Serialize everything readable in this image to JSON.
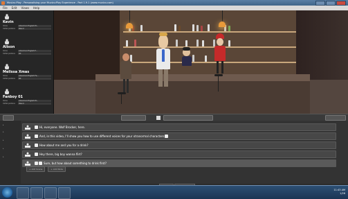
{
  "window": {
    "title": "Muvizu:Play - Personalising your Muvizu:Play Experience - Part 1.9.1 (www.muvizu.com)",
    "menu": [
      "File",
      "Edit",
      "Views",
      "Help"
    ]
  },
  "sidebar": {
    "characters": [
      {
        "name": "Kevin",
        "voice_label": "Voice",
        "voice": "American English M...",
        "pose_label": "Initial posture",
        "pose": "Stand"
      },
      {
        "name": "Alison",
        "voice_label": "Voice",
        "voice": "American English F...",
        "pose_label": "Initial posture",
        "pose": "Sit"
      },
      {
        "name": "Melissa Xmas",
        "voice_label": "Voice",
        "voice": "American English Fe...",
        "pose_label": "Initial posture",
        "pose": "Sit"
      },
      {
        "name": "Fanboy 01",
        "voice_label": "Voice",
        "voice": "American English M...",
        "pose_label": "Initial posture",
        "pose": "Stand"
      }
    ]
  },
  "script": {
    "lines": [
      {
        "text": "Hi, everyone.  Wolf Brocker, here."
      },
      {
        "text": "And, in this video, I'll show you how to use different voices for your xtranormal characters"
      },
      {
        "text": "How about  me and you for a drink?"
      },
      {
        "text": "Hey there, big boy  wanna flirt?"
      },
      {
        "text": "Sure, but how about  something to drink first?"
      }
    ],
    "add_buttons": [
      "+ Add Scene",
      "+ Add Slide"
    ]
  },
  "bottom_tabs": [
    "Script",
    "MovieMaker"
  ],
  "tray": {
    "time": "11:43 AM",
    "date": "1/26"
  },
  "colors": {
    "accent": "#5a7fa5",
    "taskbar": "#1b3554"
  }
}
